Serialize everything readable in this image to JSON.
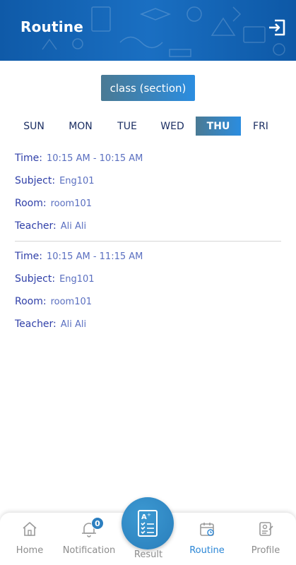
{
  "header": {
    "title": "Routine"
  },
  "class_button": {
    "label": "class (section)"
  },
  "days": {
    "sun": "SUN",
    "mon": "MON",
    "tue": "TUE",
    "wed": "WED",
    "thu": "THU",
    "fri": "FRI",
    "selected": "THU"
  },
  "labels": {
    "time": "Time:",
    "subject": "Subject:",
    "room": "Room:",
    "teacher": "Teacher:"
  },
  "entries": [
    {
      "time": "10:15 AM - 10:15 AM",
      "subject": "Eng101",
      "room": "room101",
      "teacher": "Ali Ali"
    },
    {
      "time": "10:15 AM - 11:15 AM",
      "subject": "Eng101",
      "room": "room101",
      "teacher": "Ali Ali"
    }
  ],
  "bottom_nav": {
    "home": "Home",
    "notification": "Notification",
    "notification_count": "0",
    "result": "Result",
    "routine": "Routine",
    "profile": "Profile",
    "active": "Routine"
  },
  "colors": {
    "header": "#1565b3",
    "accent": "#2a86d6",
    "label_text": "#2f3fa8",
    "value_text": "#5a6fc0"
  }
}
